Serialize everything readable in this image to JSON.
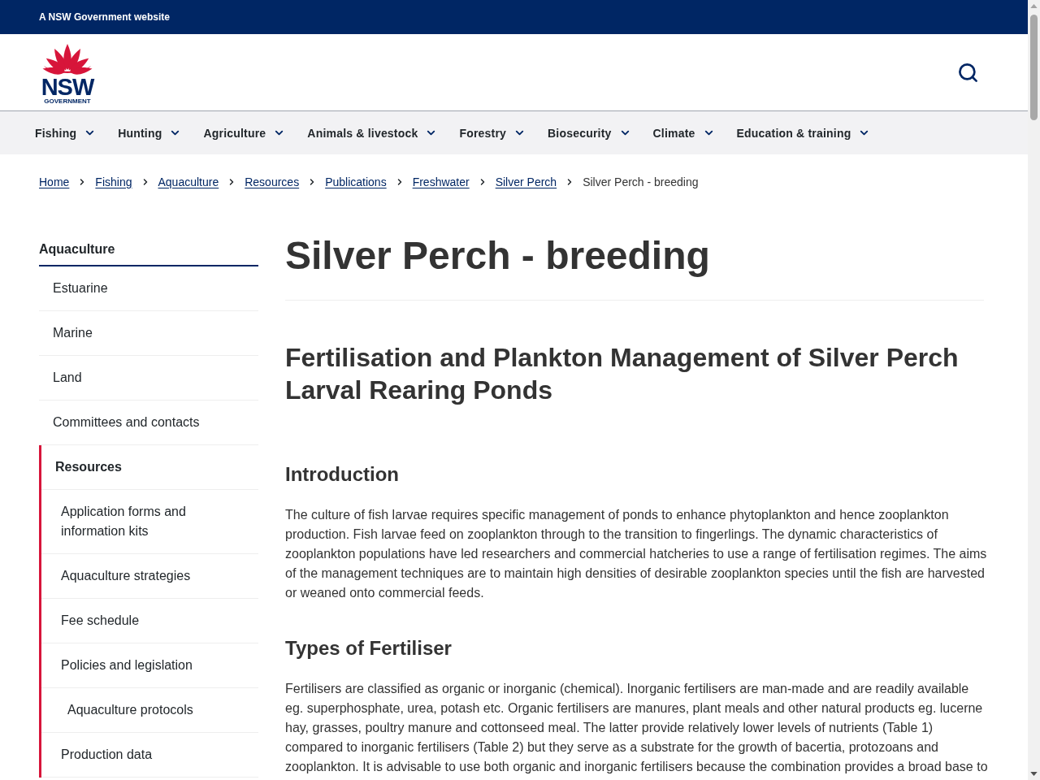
{
  "masthead": {
    "text": "A NSW Government website"
  },
  "logo": {
    "wordmark": "NSW",
    "subtitle": "GOVERNMENT"
  },
  "nav": [
    {
      "label": "Fishing"
    },
    {
      "label": "Hunting"
    },
    {
      "label": "Agriculture"
    },
    {
      "label": "Animals & livestock"
    },
    {
      "label": "Forestry"
    },
    {
      "label": "Biosecurity"
    },
    {
      "label": "Climate"
    },
    {
      "label": "Education & training"
    }
  ],
  "breadcrumbs": [
    {
      "label": "Home",
      "current": false
    },
    {
      "label": "Fishing",
      "current": false
    },
    {
      "label": "Aquaculture",
      "current": false
    },
    {
      "label": "Resources",
      "current": false
    },
    {
      "label": "Publications",
      "current": false
    },
    {
      "label": "Freshwater",
      "current": false
    },
    {
      "label": "Silver Perch",
      "current": false
    },
    {
      "label": "Silver Perch - breeding",
      "current": true
    }
  ],
  "sidebar": {
    "heading": "Aquaculture",
    "items": [
      {
        "label": "Estuarine",
        "active": false
      },
      {
        "label": "Marine",
        "active": false
      },
      {
        "label": "Land",
        "active": false
      },
      {
        "label": "Committees and contacts",
        "active": false
      },
      {
        "label": "Resources",
        "active": true,
        "children": [
          {
            "label": "Application forms and information kits"
          },
          {
            "label": "Aquaculture strategies"
          },
          {
            "label": "Fee schedule"
          },
          {
            "label": "Policies and legislation",
            "children": [
              {
                "label": "Aquaculture protocols"
              }
            ]
          },
          {
            "label": "Production data"
          }
        ]
      }
    ]
  },
  "page": {
    "title": "Silver Perch - breeding",
    "subtitle": "Fertilisation and Plankton Management of Silver Perch Larval Rearing Ponds",
    "sections": [
      {
        "heading": "Introduction",
        "paragraph": "The culture of fish larvae requires specific management of ponds to enhance phytoplankton and hence zooplankton production. Fish larvae feed on zooplankton through to the transition to fingerlings. The dynamic characteristics of zooplankton populations have led researchers and commercial hatcheries to use a range of fertilisation regimes. The aims of the management techniques are to maintain high densities of desirable zooplankton species until the fish are harvested or weaned onto commercial feeds."
      },
      {
        "heading": "Types of Fertiliser",
        "paragraph": "Fertilisers are classified as organic or inorganic (chemical). Inorganic fertilisers are man-made and are readily available eg. superphosphate, urea, potash etc. Organic fertilisers are manures, plant meals and other natural products eg. lucerne hay, grasses, poultry manure and cottonseed meal. The latter provide relatively lower levels of nutrients (Table 1) compared to inorganic fertilisers (Table 2) but they serve as a substrate for the growth of bacertia, protozoans and zooplankton. It is advisable to use both organic and inorganic fertilisers because the combination provides a broad base to"
      }
    ]
  }
}
